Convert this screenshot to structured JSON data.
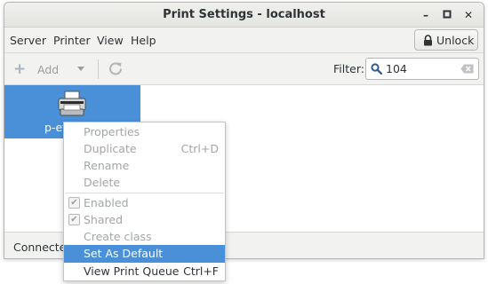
{
  "window": {
    "title": "Print Settings - localhost",
    "minimize_glyph": "–",
    "maximize_glyph": "▫",
    "close_glyph": "✕"
  },
  "menubar": {
    "items": [
      "Server",
      "Printer",
      "View",
      "Help"
    ],
    "unlock_label": "Unlock"
  },
  "toolbar": {
    "add_label": "Add",
    "filter_label": "Filter:",
    "filter_value": "104"
  },
  "printers": [
    {
      "name": "p-et"
    }
  ],
  "status": {
    "text": "Connected"
  },
  "context_menu": {
    "items": [
      {
        "label": "Properties",
        "accel": "",
        "state": "disabled"
      },
      {
        "label": "Duplicate",
        "accel": "Ctrl+D",
        "state": "disabled"
      },
      {
        "label": "Rename",
        "accel": "",
        "state": "disabled"
      },
      {
        "label": "Delete",
        "accel": "",
        "state": "disabled"
      },
      {
        "label": "Enabled",
        "accel": "",
        "state": "disabled",
        "checked": true
      },
      {
        "label": "Shared",
        "accel": "",
        "state": "disabled",
        "checked": true
      },
      {
        "label": "Create class",
        "accel": "",
        "state": "disabled"
      },
      {
        "label": "Set As Default",
        "accel": "",
        "state": "highlighted"
      },
      {
        "label": "View Print Queue",
        "accel": "Ctrl+F",
        "state": "normal"
      }
    ]
  },
  "colors": {
    "accent": "#4a90d9",
    "disabled_text": "#a2a6a7"
  }
}
